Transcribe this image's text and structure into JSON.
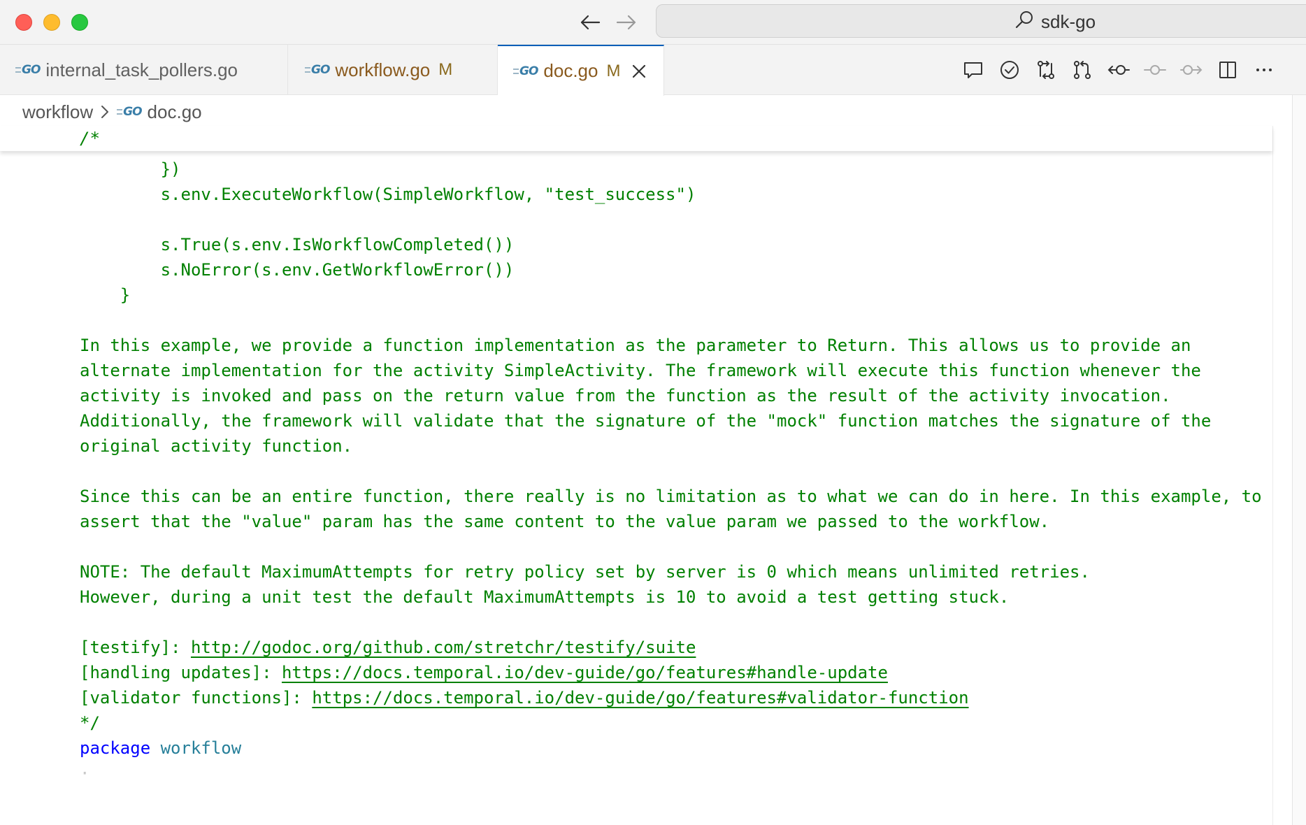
{
  "window": {
    "search_label": "sdk-go"
  },
  "tabs": [
    {
      "label": "internal_task_pollers.go",
      "modified": ""
    },
    {
      "label": "workflow.go",
      "modified": "M"
    },
    {
      "label": "doc.go",
      "modified": "M"
    }
  ],
  "toolbar": {
    "icons": [
      "comment-icon",
      "check-circle-icon",
      "compare-changes-icon",
      "pull-request-icon",
      "previous-change-icon",
      "commit-icon",
      "next-change-icon",
      "split-editor-icon",
      "more-actions-icon"
    ]
  },
  "breadcrumb": {
    "folder": "workflow",
    "file": "doc.go"
  },
  "editor": {
    "sticky_line": "/*",
    "lines": [
      "        })",
      "        s.env.ExecuteWorkflow(SimpleWorkflow, \"test_success\")",
      "",
      "        s.True(s.env.IsWorkflowCompleted())",
      "        s.NoError(s.env.GetWorkflowError())",
      "    }",
      "",
      "In this example, we provide a function implementation as the parameter to Return. This allows us to provide an",
      "alternate implementation for the activity SimpleActivity. The framework will execute this function whenever the",
      "activity is invoked and pass on the return value from the function as the result of the activity invocation.",
      "Additionally, the framework will validate that the signature of the \"mock\" function matches the signature of the",
      "original activity function.",
      "",
      "Since this can be an entire function, there really is no limitation as to what we can do in here. In this example, to",
      "assert that the \"value\" param has the same content to the value param we passed to the workflow.",
      "",
      "NOTE: The default MaximumAttempts for retry policy set by server is 0 which means unlimited retries.",
      "However, during a unit test the default MaximumAttempts is 10 to avoid a test getting stuck.",
      ""
    ],
    "links": [
      {
        "label": "[testify]: ",
        "url": "http://godoc.org/github.com/stretchr/testify/suite"
      },
      {
        "label": "[handling updates]: ",
        "url": "https://docs.temporal.io/dev-guide/go/features#handle-update"
      },
      {
        "label": "[validator functions]: ",
        "url": "https://docs.temporal.io/dev-guide/go/features#validator-function"
      }
    ],
    "comment_end": "*/",
    "package_keyword": "package",
    "package_name": "workflow",
    "trailing_whitespace": "·"
  },
  "colors": {
    "comment": "#008000",
    "keyword": "#0000ff",
    "package": "#267f99",
    "active_tab_border": "#005fb8"
  }
}
